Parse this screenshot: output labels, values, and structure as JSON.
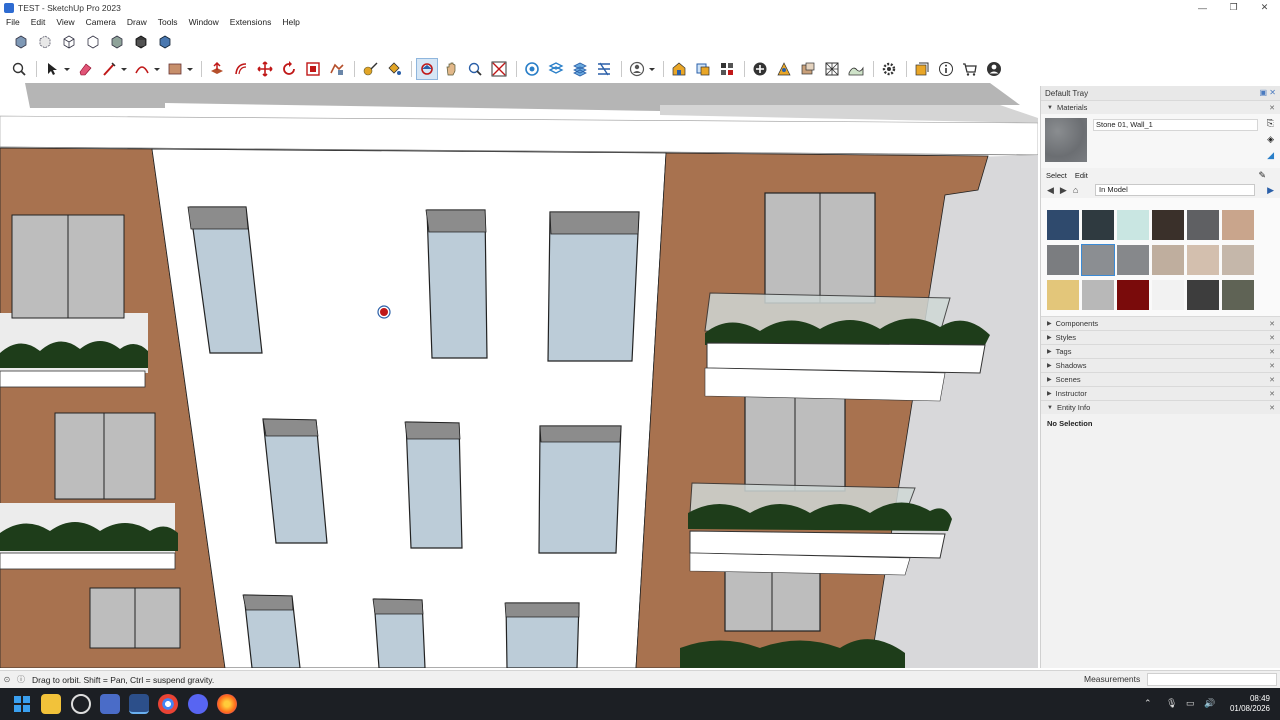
{
  "window": {
    "title": "TEST - SketchUp Pro 2023",
    "minimize": "—",
    "maximize": "❐",
    "close": "✕"
  },
  "menu": [
    "File",
    "Edit",
    "View",
    "Camera",
    "Draw",
    "Tools",
    "Window",
    "Extensions",
    "Help"
  ],
  "toolbar_row1": [
    "xray-icon",
    "back-edges-icon",
    "wireframe-icon",
    "hidden-line-icon",
    "shaded-icon",
    "shaded-textures-icon",
    "monochrome-icon"
  ],
  "toolbar_row2": [
    "zoom-icon",
    "select-icon",
    "eraser-icon",
    "line-icon",
    "arc-icon",
    "rectangle-icon",
    "push-pull-icon",
    "offset-icon",
    "move-icon",
    "rotate-icon",
    "scale-icon",
    "follow-me-icon",
    "tape-measure-icon",
    "paint-bucket-icon",
    "orbit-icon",
    "pan-icon",
    "zoom-window-icon",
    "zoom-extents-icon",
    "section-plane-icon",
    "display-sections-icon",
    "section-cuts-icon",
    "section-fill-icon",
    "account-icon",
    "warehouse-icon",
    "components-icon",
    "extension-warehouse-icon",
    "add-location-icon",
    "photo-texture-icon",
    "match-photo-icon",
    "solid-tools-icon",
    "sandbox-icon",
    "extension-manager-icon",
    "generate-report-icon",
    "info-icon",
    "store-icon",
    "profile-icon"
  ],
  "tray": {
    "title": "Default Tray",
    "materials": {
      "label": "Materials",
      "current_name": "Stone 01, Wall_1",
      "tab_select": "Select",
      "tab_edit": "Edit",
      "library": "In Model",
      "swatches": [
        "#2f4a6d",
        "#2f3a40",
        "#c9e6e2",
        "#3a302a",
        "#5f6063",
        "#c9a58c",
        "#7b7d80",
        "#8b8e92",
        "#86888b",
        "#bfae9e",
        "#d3bfae",
        "#c5b7aa",
        "#e3c67a",
        "#b8b8b8",
        "#7a0b0b",
        "#f2f2f2",
        "#3d3d3d",
        "#5f6355"
      ]
    },
    "sections": [
      "Components",
      "Styles",
      "Tags",
      "Shadows",
      "Scenes",
      "Instructor",
      "Entity Info"
    ],
    "entity_info": "No Selection"
  },
  "status": {
    "hint": "Drag to orbit. Shift = Pan, Ctrl = suspend gravity.",
    "measurements": "Measurements"
  },
  "clock": {
    "time": "08:49",
    "date": "01/08/2026"
  }
}
